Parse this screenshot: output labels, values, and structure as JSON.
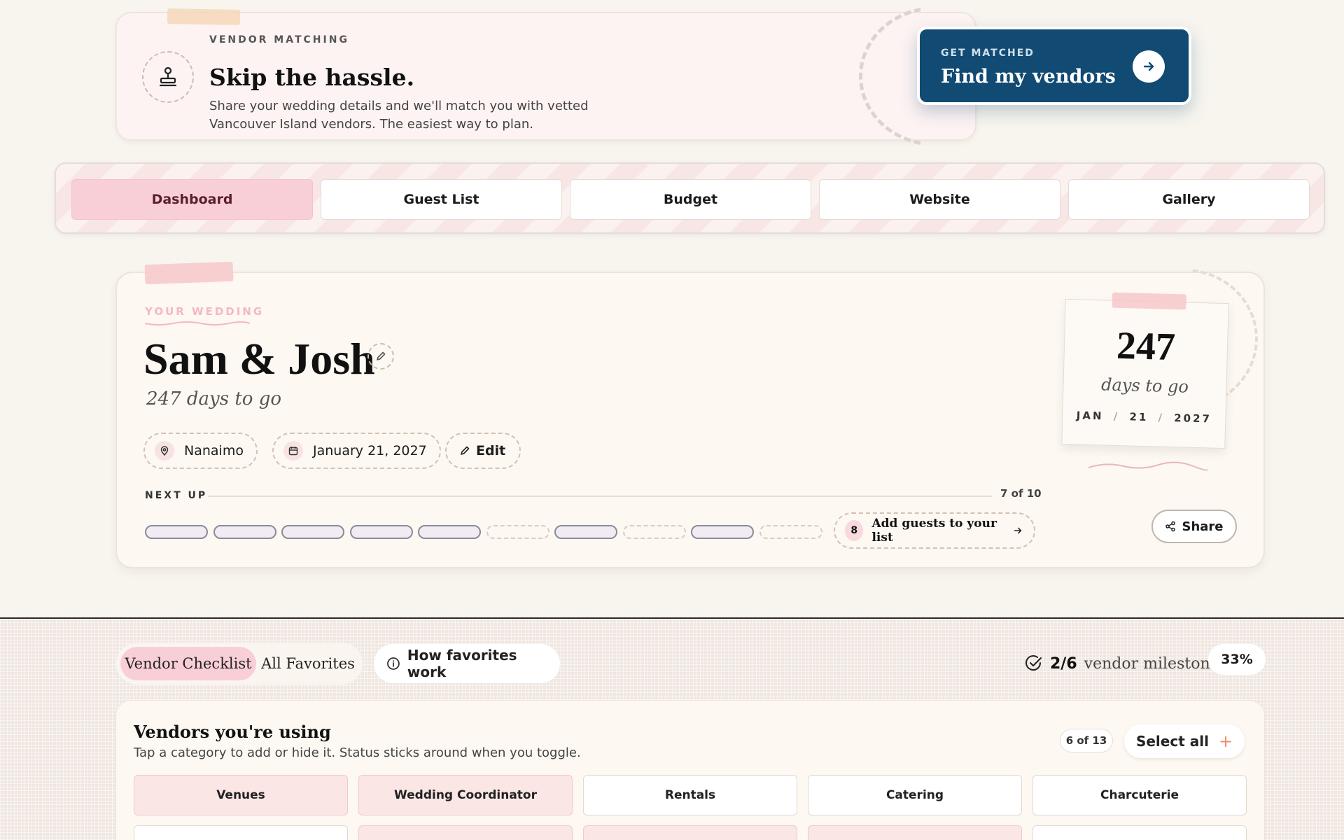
{
  "banner": {
    "eyebrow": "VENDOR MATCHING",
    "title": "Skip the hassle.",
    "description": "Share your wedding details and we'll match you with vetted Vancouver Island vendors. The easiest way to plan.",
    "cta_eyebrow": "GET MATCHED",
    "cta_label": "Find my vendors"
  },
  "tabs": [
    {
      "label": "Dashboard",
      "active": true
    },
    {
      "label": "Guest List",
      "active": false
    },
    {
      "label": "Budget",
      "active": false
    },
    {
      "label": "Website",
      "active": false
    },
    {
      "label": "Gallery",
      "active": false
    }
  ],
  "wedding": {
    "eyebrow": "YOUR WEDDING",
    "couple": "Sam & Josh",
    "days_to_go": "247 days to go",
    "location": "Nanaimo",
    "date": "January 21, 2027",
    "edit_label": "Edit",
    "next_up_label": "NEXT UP",
    "progress_text": "7 of 10",
    "progress_steps": [
      true,
      true,
      true,
      true,
      true,
      false,
      true,
      false,
      true,
      false
    ],
    "next_task_number": "8",
    "next_task_label": "Add guests to your list",
    "share_label": "Share",
    "countdown": {
      "days": "247",
      "caption": "days to go",
      "month": "JAN",
      "day": "21",
      "year": "2027"
    }
  },
  "vendors": {
    "toggle_active": "Vendor Checklist",
    "toggle_inactive": "All Favorites",
    "how_label": "How favorites work",
    "milestones_count": "2/6",
    "milestones_text": "vendor milestones",
    "milestones_pct": "33%",
    "card_title": "Vendors you're using",
    "card_desc": "Tap a category to add or hide it. Status sticks around when you toggle.",
    "count_badge": "6 of 13",
    "select_all": "Select all",
    "categories": [
      {
        "label": "Venues",
        "selected": true
      },
      {
        "label": "Wedding Coordinator",
        "selected": true
      },
      {
        "label": "Rentals",
        "selected": false
      },
      {
        "label": "Catering",
        "selected": false
      },
      {
        "label": "Charcuterie",
        "selected": false
      }
    ]
  },
  "colors": {
    "accent_navy": "#114a72",
    "accent_pink": "#f9cfd7",
    "background": "#f8f5ef"
  }
}
